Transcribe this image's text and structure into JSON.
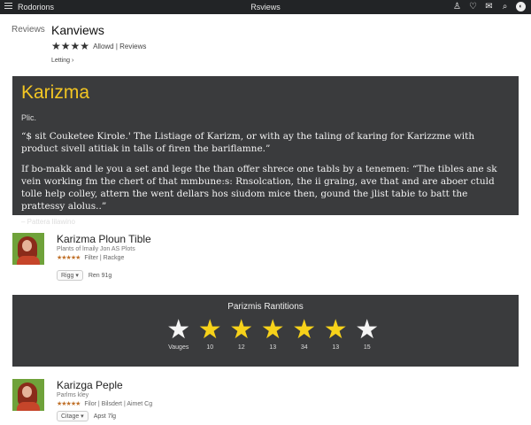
{
  "topbar": {
    "brand": "Rodorions",
    "center_title": "Rsviews",
    "icons": [
      "user-icon",
      "heart-icon",
      "mail-icon",
      "search-icon",
      "avatar"
    ]
  },
  "breadcrumb": "Reviews",
  "page": {
    "title": "Kanviews",
    "rating_meta": "Allowd | Reviews",
    "sub_link": "Letting ›"
  },
  "hero": {
    "heading": "Karizma",
    "kicker": "Plic.",
    "paragraph1": "“$ sit Couketee Kirole.' The Listiage of Karizm, or with ay the taling of karing for Karizzme with product sivell atitiak in talls of firen the bariflamne.”",
    "paragraph2": "If bo-makk and le you a set and lege the than offer shrece one tabls by a tenemen: “The tibles ane sk vein working fm the chert of that mmbune:s: Rnsolcation, the ii graing, ave that and are aboer ctuld tolle help colley, attern the went dellars hos siudom mice then, gound the jlist tabie to batt the prattessy alolus..”",
    "signature": "– Pattera lilawino"
  },
  "cards": [
    {
      "title": "Karizma Ploun Tible",
      "subtitle": "Plants of lmaily Jon AS Plots",
      "rating_text": "Filter | Rackge",
      "chip": "Rigg ▾",
      "foot": "Ren 91g"
    },
    {
      "title": "Karizga Peple",
      "subtitle": "Parlms kley",
      "rating_text": "Filor | Bilsdert | Aimet Cg",
      "chip": "Citage ▾",
      "foot": "Apst 7lg"
    }
  ],
  "ratings": {
    "title": "Parizmis Rantitions",
    "gold": "#f7d21a",
    "white": "#f5f5f5",
    "stars": [
      {
        "color": "white",
        "label": "Vauges"
      },
      {
        "color": "gold",
        "label": "10"
      },
      {
        "color": "gold",
        "label": "12"
      },
      {
        "color": "gold",
        "label": "13"
      },
      {
        "color": "gold",
        "label": "34"
      },
      {
        "color": "gold",
        "label": "13"
      },
      {
        "color": "white",
        "label": "15"
      }
    ]
  }
}
